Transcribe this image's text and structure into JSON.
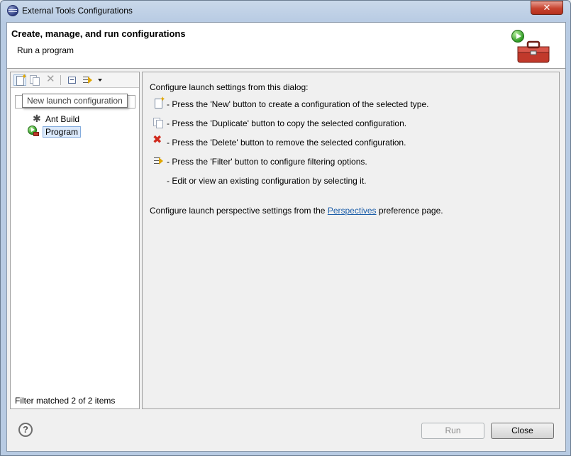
{
  "window": {
    "title": "External Tools Configurations",
    "close_glyph": "✕"
  },
  "header": {
    "title": "Create, manage, and run configurations",
    "subtitle": "Run a program"
  },
  "left_panel": {
    "toolbar": {
      "new_icon": "new-document-icon",
      "duplicate_icon": "duplicate-icon",
      "delete_icon": "delete-icon",
      "collapse_icon": "collapse-all-icon",
      "filter_icon": "filter-icon"
    },
    "tooltip": "New launch configuration",
    "filter_placeholder": "",
    "tree": [
      {
        "label": "Ant Build",
        "icon": "ant-icon",
        "selected": false
      },
      {
        "label": "Program",
        "icon": "program-icon",
        "selected": true
      }
    ],
    "status": "Filter matched 2 of 2 items"
  },
  "right_panel": {
    "intro": "Configure launch settings from this dialog:",
    "items": [
      {
        "icon": "new-document-icon",
        "text": "- Press the 'New' button to create a configuration of the selected type."
      },
      {
        "icon": "duplicate-icon",
        "text": "- Press the 'Duplicate' button to copy the selected configuration."
      },
      {
        "icon": "delete-icon",
        "text": "- Press the 'Delete' button to remove the selected configuration."
      },
      {
        "icon": "filter-icon",
        "text": "- Press the 'Filter' button to configure filtering options."
      },
      {
        "icon": "",
        "text": "- Edit or view an existing configuration by selecting it."
      }
    ],
    "perspective_before": "Configure launch perspective settings from the ",
    "perspective_link": "Perspectives",
    "perspective_after": " preference page."
  },
  "footer": {
    "help_glyph": "?",
    "run_label": "Run",
    "close_label": "Close"
  },
  "colors": {
    "link": "#1c5ea9",
    "selection_bg": "#dbe9fb",
    "close_red": "#c7432f"
  }
}
